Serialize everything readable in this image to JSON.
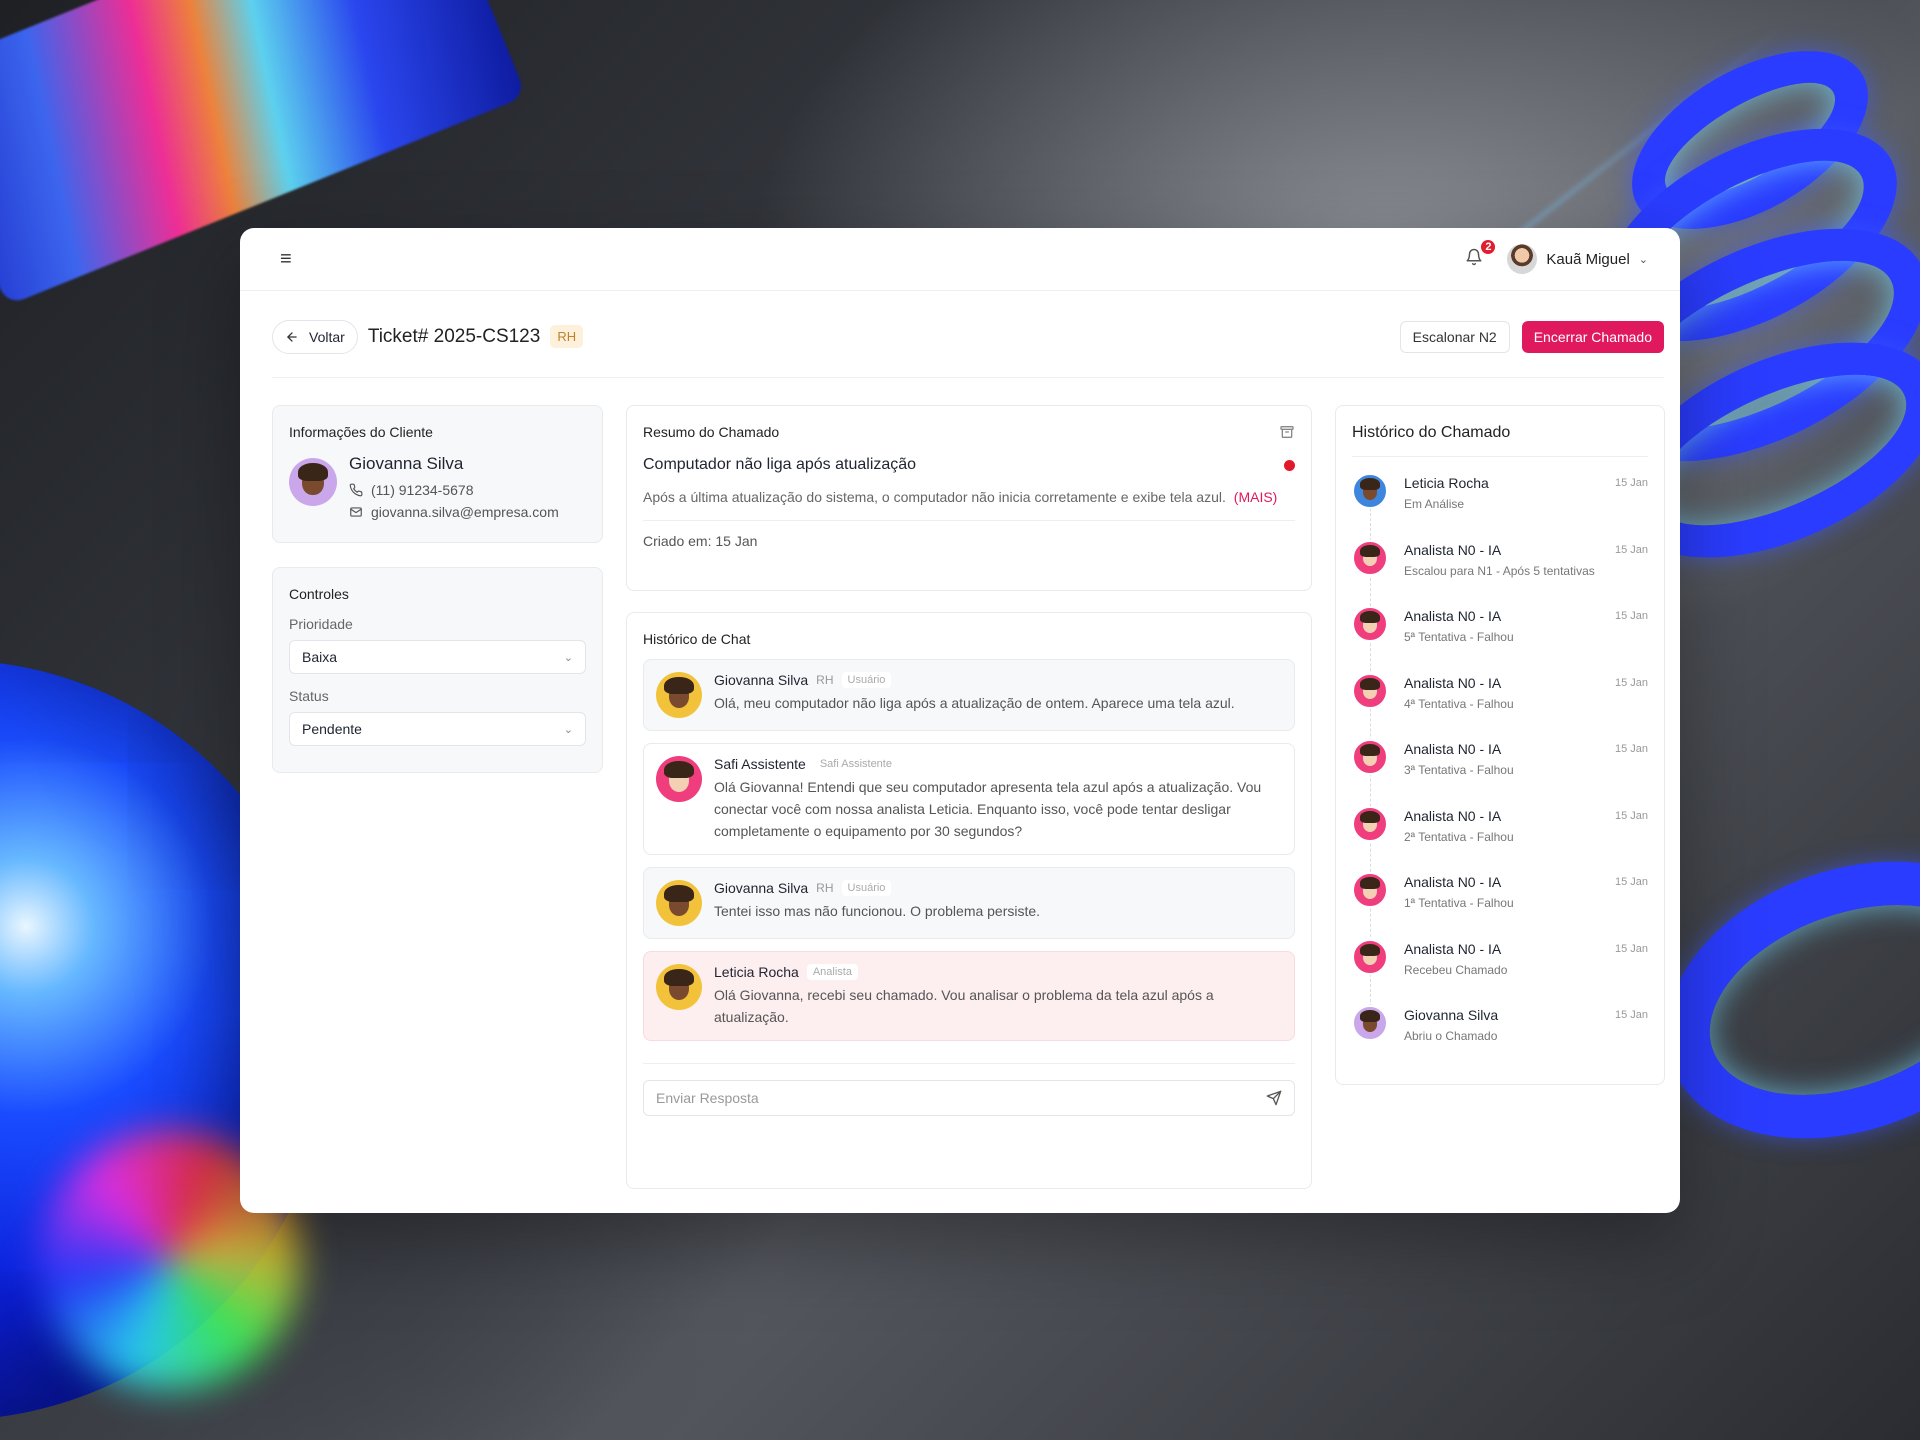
{
  "topbar": {
    "notifications_count": "2",
    "user_name": "Kauã Miguel"
  },
  "header": {
    "back_label": "Voltar",
    "ticket_title": "Ticket# 2025-CS123",
    "dept_tag": "RH",
    "escalate_label": "Escalonar N2",
    "close_label": "Encerrar Chamado",
    "accent_color": "#e0195f"
  },
  "client": {
    "title": "Informações do Cliente",
    "name": "Giovanna Silva",
    "phone": "(11) 91234-5678",
    "email": "giovanna.silva@empresa.com"
  },
  "controls": {
    "title": "Controles",
    "priority_label": "Prioridade",
    "priority_value": "Baixa",
    "status_label": "Status",
    "status_value": "Pendente"
  },
  "summary": {
    "title": "Resumo do Chamado",
    "subject": "Computador não liga após atualização",
    "description": "Após a última atualização do sistema, o computador não inicia corretamente e exibe tela azul.",
    "more_label": "(MAIS)",
    "created_label": "Criado em:",
    "created_value": "15 Jan"
  },
  "chat": {
    "title": "Histórico de Chat",
    "reply_placeholder": "Enviar Resposta",
    "messages": [
      {
        "name": "Giovanna Silva",
        "dept": "RH",
        "role": "Usuário",
        "text": "Olá, meu computador não liga após a atualização de ontem. Aparece uma tela azul."
      },
      {
        "name": "Safi Assistente",
        "dept": "",
        "role": "Safi Assistente",
        "text": "Olá Giovanna! Entendi que seu computador apresenta tela azul após a atualização. Vou conectar você com nossa analista Leticia. Enquanto isso, você pode tentar desligar completamente o equipamento por 30 segundos?"
      },
      {
        "name": "Giovanna Silva",
        "dept": "RH",
        "role": "Usuário",
        "text": "Tentei isso mas não funcionou. O problema persiste."
      },
      {
        "name": "Leticia Rocha",
        "dept": "",
        "role": "Analista",
        "text": "Olá Giovanna, recebi seu chamado. Vou analisar o problema da tela azul após a atualização."
      }
    ]
  },
  "history": {
    "title": "Histórico do Chamado",
    "items": [
      {
        "name": "Leticia Rocha",
        "status": "Em Análise",
        "date": "15 Jan"
      },
      {
        "name": "Analista N0 - IA",
        "status": "Escalou para N1 - Após 5 tentativas",
        "date": "15 Jan"
      },
      {
        "name": "Analista N0 - IA",
        "status": "5ª Tentativa - Falhou",
        "date": "15 Jan"
      },
      {
        "name": "Analista N0 - IA",
        "status": "4ª Tentativa - Falhou",
        "date": "15 Jan"
      },
      {
        "name": "Analista N0 - IA",
        "status": "3ª Tentativa - Falhou",
        "date": "15 Jan"
      },
      {
        "name": "Analista N0 - IA",
        "status": "2ª Tentativa - Falhou",
        "date": "15 Jan"
      },
      {
        "name": "Analista N0 - IA",
        "status": "1ª Tentativa - Falhou",
        "date": "15 Jan"
      },
      {
        "name": "Analista N0 - IA",
        "status": "Recebeu Chamado",
        "date": "15 Jan"
      },
      {
        "name": "Giovanna Silva",
        "status": "Abriu o Chamado",
        "date": "15 Jan"
      }
    ]
  }
}
